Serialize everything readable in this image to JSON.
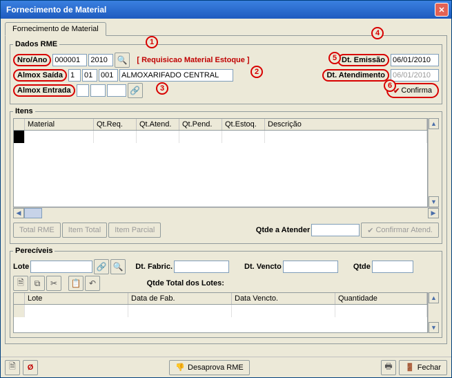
{
  "window": {
    "title": "Fornecimento de Material"
  },
  "tab": {
    "label": "Fornecimento de Material"
  },
  "dados_rme": {
    "legend": "Dados RME",
    "nro_ano_label": "Nro/Ano",
    "nro": "000001",
    "ano": "2010",
    "req_text": "[ Requisicao Material Estoque ]",
    "almox_saida_label": "Almox Saída",
    "almox_saida_a": "1",
    "almox_saida_b": "01",
    "almox_saida_c": "001",
    "almox_saida_nome": "ALMOXARIFADO CENTRAL",
    "almox_entrada_label": "Almox Entrada",
    "dt_emissao_label": "Dt. Emissão",
    "dt_emissao": "06/01/2010",
    "dt_atend_label": "Dt. Atendimento",
    "dt_atend": "06/01/2010",
    "confirma_label": "Confirma"
  },
  "itens": {
    "legend": "Itens",
    "cols": {
      "material": "Material",
      "qtreq": "Qt.Req.",
      "qtatend": "Qt.Atend.",
      "qtpend": "Qt.Pend.",
      "qtestq": "Qt.Estoq.",
      "desc": "Descrição"
    },
    "btn_total_rme": "Total RME",
    "btn_item_total": "Item Total",
    "btn_item_parcial": "Item Parcial",
    "qtde_atender_label": "Qtde a Atender",
    "btn_conf_atend": "Confirmar Atend."
  },
  "pereciveis": {
    "legend": "Perecíveis",
    "lote_label": "Lote",
    "dt_fab_label": "Dt. Fabric.",
    "dt_venc_label": "Dt. Vencto",
    "qtde_label": "Qtde",
    "qtde_total_label": "Qtde Total dos Lotes:",
    "cols": {
      "lote": "Lote",
      "fab": "Data de Fab.",
      "venc": "Data Vencto.",
      "qtd": "Quantidade"
    }
  },
  "bottom": {
    "desaprova": "Desaprova RME",
    "fechar": "Fechar"
  },
  "callouts": {
    "c1": "1",
    "c2": "2",
    "c3": "3",
    "c4": "4",
    "c5": "5",
    "c6": "6"
  }
}
